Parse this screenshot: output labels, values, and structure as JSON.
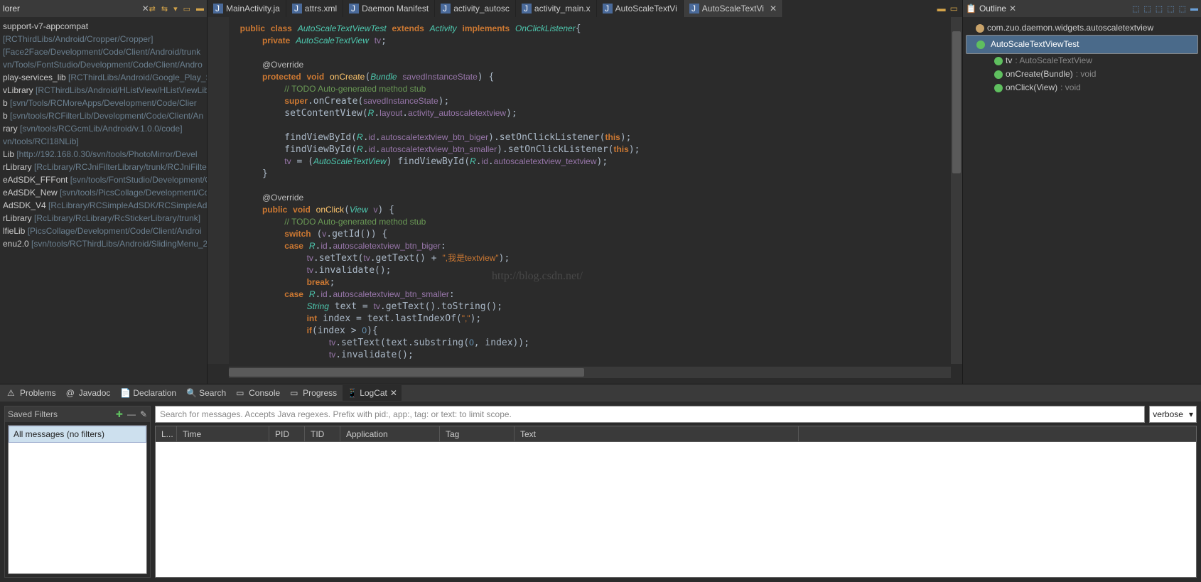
{
  "explorer": {
    "title": "lorer",
    "items": [
      {
        "n": "support-v7-appcompat",
        "p": ""
      },
      {
        "n": "",
        "p": "[RCThirdLibs/Android/Cropper/Cropper]"
      },
      {
        "n": "",
        "p": "[Face2Face/Development/Code/Client/Android/trunk"
      },
      {
        "n": "",
        "p": "vn/Tools/FontStudio/Development/Code/Client/Andro"
      },
      {
        "n": "play-services_lib",
        "p": " [RCThirdLibs/Android/Google_Play_Se"
      },
      {
        "n": "vLibrary",
        "p": " [RCThirdLibs/Android/HListView/HListViewLib"
      },
      {
        "n": "b",
        "p": " [svn/Tools/RCMoreApps/Development/Code/Clier"
      },
      {
        "n": "b",
        "p": " [svn/tools/RCFilterLib/Development/Code/Client/An"
      },
      {
        "n": "rary",
        "p": " [svn/tools/RCGcmLib/Android/v.1.0.0/code]"
      },
      {
        "n": "",
        "p": "vn/tools/RCI18NLib]"
      },
      {
        "n": "Lib",
        "p": " [http://192.168.0.30/svn/tools/PhotoMirror/Devel"
      },
      {
        "n": "rLibrary",
        "p": " [RcLibrary/RCJniFilterLibrary/trunk/RCJniFilter"
      },
      {
        "n": "eAdSDK_FFFont",
        "p": " [svn/tools/FontStudio/Development/Co"
      },
      {
        "n": "eAdSDK_New",
        "p": " [svn/tools/PicsCollage/Development/Cod"
      },
      {
        "n": "AdSDK_V4",
        "p": " [RcLibrary/RCSimpleAdSDK/RCSimpleAdSD"
      },
      {
        "n": "rLibrary",
        "p": " [RcLibrary/RcLibrary/RcStickerLibrary/trunk]"
      },
      {
        "n": "lfieLib",
        "p": " [PicsCollage/Development/Code/Client/Androi"
      },
      {
        "n": "enu2.0",
        "p": " [svn/tools/RCThirdLibs/Android/SlidingMenu_2"
      }
    ]
  },
  "tabs": [
    {
      "l": "MainActivity.ja"
    },
    {
      "l": "attrs.xml"
    },
    {
      "l": "Daemon Manifest"
    },
    {
      "l": "activity_autosc"
    },
    {
      "l": "activity_main.x"
    },
    {
      "l": "AutoScaleTextVi"
    },
    {
      "l": "AutoScaleTextVi",
      "active": true
    }
  ],
  "watermark": "http://blog.csdn.net/",
  "outline": {
    "title": "Outline",
    "pkg": "com.zuo.daemon.widgets.autoscaletextview",
    "cls": "AutoScaleTextViewTest",
    "members": [
      {
        "n": "tv",
        "t": ": AutoScaleTextView"
      },
      {
        "n": "onCreate(Bundle)",
        "t": ": void"
      },
      {
        "n": "onClick(View)",
        "t": ": void"
      }
    ]
  },
  "bottomTabs": [
    "Problems",
    "Javadoc",
    "Declaration",
    "Search",
    "Console",
    "Progress",
    "LogCat"
  ],
  "filters": {
    "title": "Saved Filters",
    "item": "All messages (no filters)"
  },
  "log": {
    "searchPlaceholder": "Search for messages. Accepts Java regexes. Prefix with pid:, app:, tag: or text: to limit scope.",
    "level": "verbose",
    "cols": [
      "L...",
      "Time",
      "PID",
      "TID",
      "Application",
      "Tag",
      "Text"
    ]
  }
}
